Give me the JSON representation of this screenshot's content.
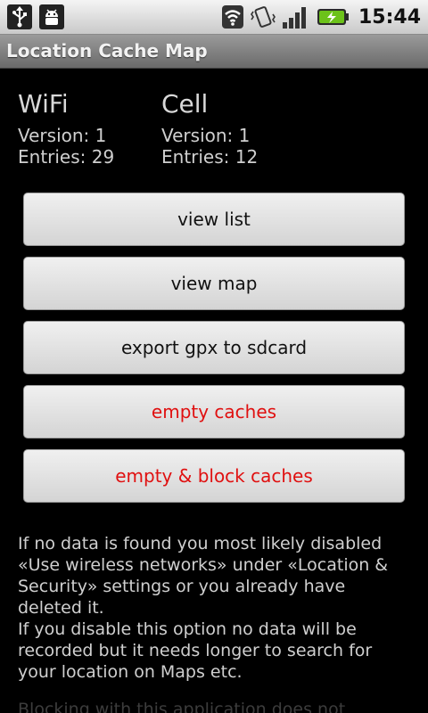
{
  "status_bar": {
    "time": "15:44",
    "left_icons": [
      "usb-icon",
      "android-debug-icon"
    ],
    "right_icons": [
      "wifi-icon",
      "vibrate-icon",
      "signal-icon",
      "battery-icon"
    ]
  },
  "app": {
    "title": "Location Cache Map"
  },
  "wifi": {
    "heading": "WiFi",
    "version": "Version: 1",
    "entries": "Entries: 29"
  },
  "cell": {
    "heading": "Cell",
    "version": "Version: 1",
    "entries": "Entries: 12"
  },
  "buttons": {
    "view_list": "view list",
    "view_map": "view map",
    "export_gpx": "export gpx to sdcard",
    "empty_caches": "empty caches",
    "empty_block": "empty & block caches"
  },
  "colors": {
    "warning_text": "#e01010",
    "background": "#000000"
  },
  "info": {
    "paragraph1": "If no data is found you most likely disabled «Use wireless networks» under «Location & Security» settings or you already have deleted it.",
    "paragraph2": "If you disable this option no data will be recorded but it needs longer to search for your location on Maps etc.",
    "paragraph3": "Blocking with this application does not disable"
  }
}
